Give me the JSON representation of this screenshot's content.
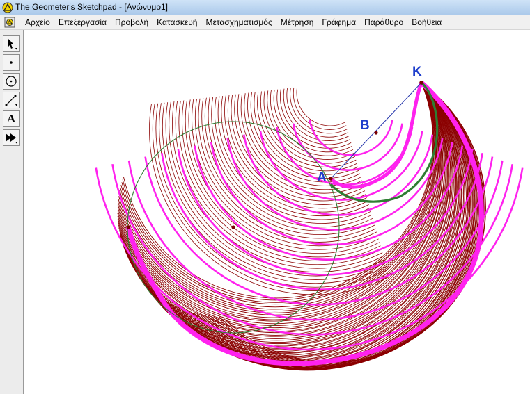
{
  "window": {
    "title": "The Geometer's Sketchpad - [Ανώνυμο1]"
  },
  "menu": {
    "items": [
      "Αρχείο",
      "Επεξεργασία",
      "Προβολή",
      "Κατασκευή",
      "Μετασχηματισμός",
      "Μέτρηση",
      "Γράφημα",
      "Παράθυρο",
      "Βοήθεια"
    ]
  },
  "toolbox": {
    "tools": [
      "selection-arrow-tool",
      "point-tool",
      "compass-tool",
      "straightedge-tool",
      "text-tool",
      "custom-tool"
    ],
    "text_tool_glyph": "A"
  },
  "sketch": {
    "labels": {
      "k": "K",
      "b": "B",
      "a": "A"
    },
    "colors": {
      "trace": "#ff22ee",
      "family": "#8b0000",
      "circle": "#2e7d32",
      "segment": "#2233aa",
      "point": "#7a0000"
    }
  }
}
